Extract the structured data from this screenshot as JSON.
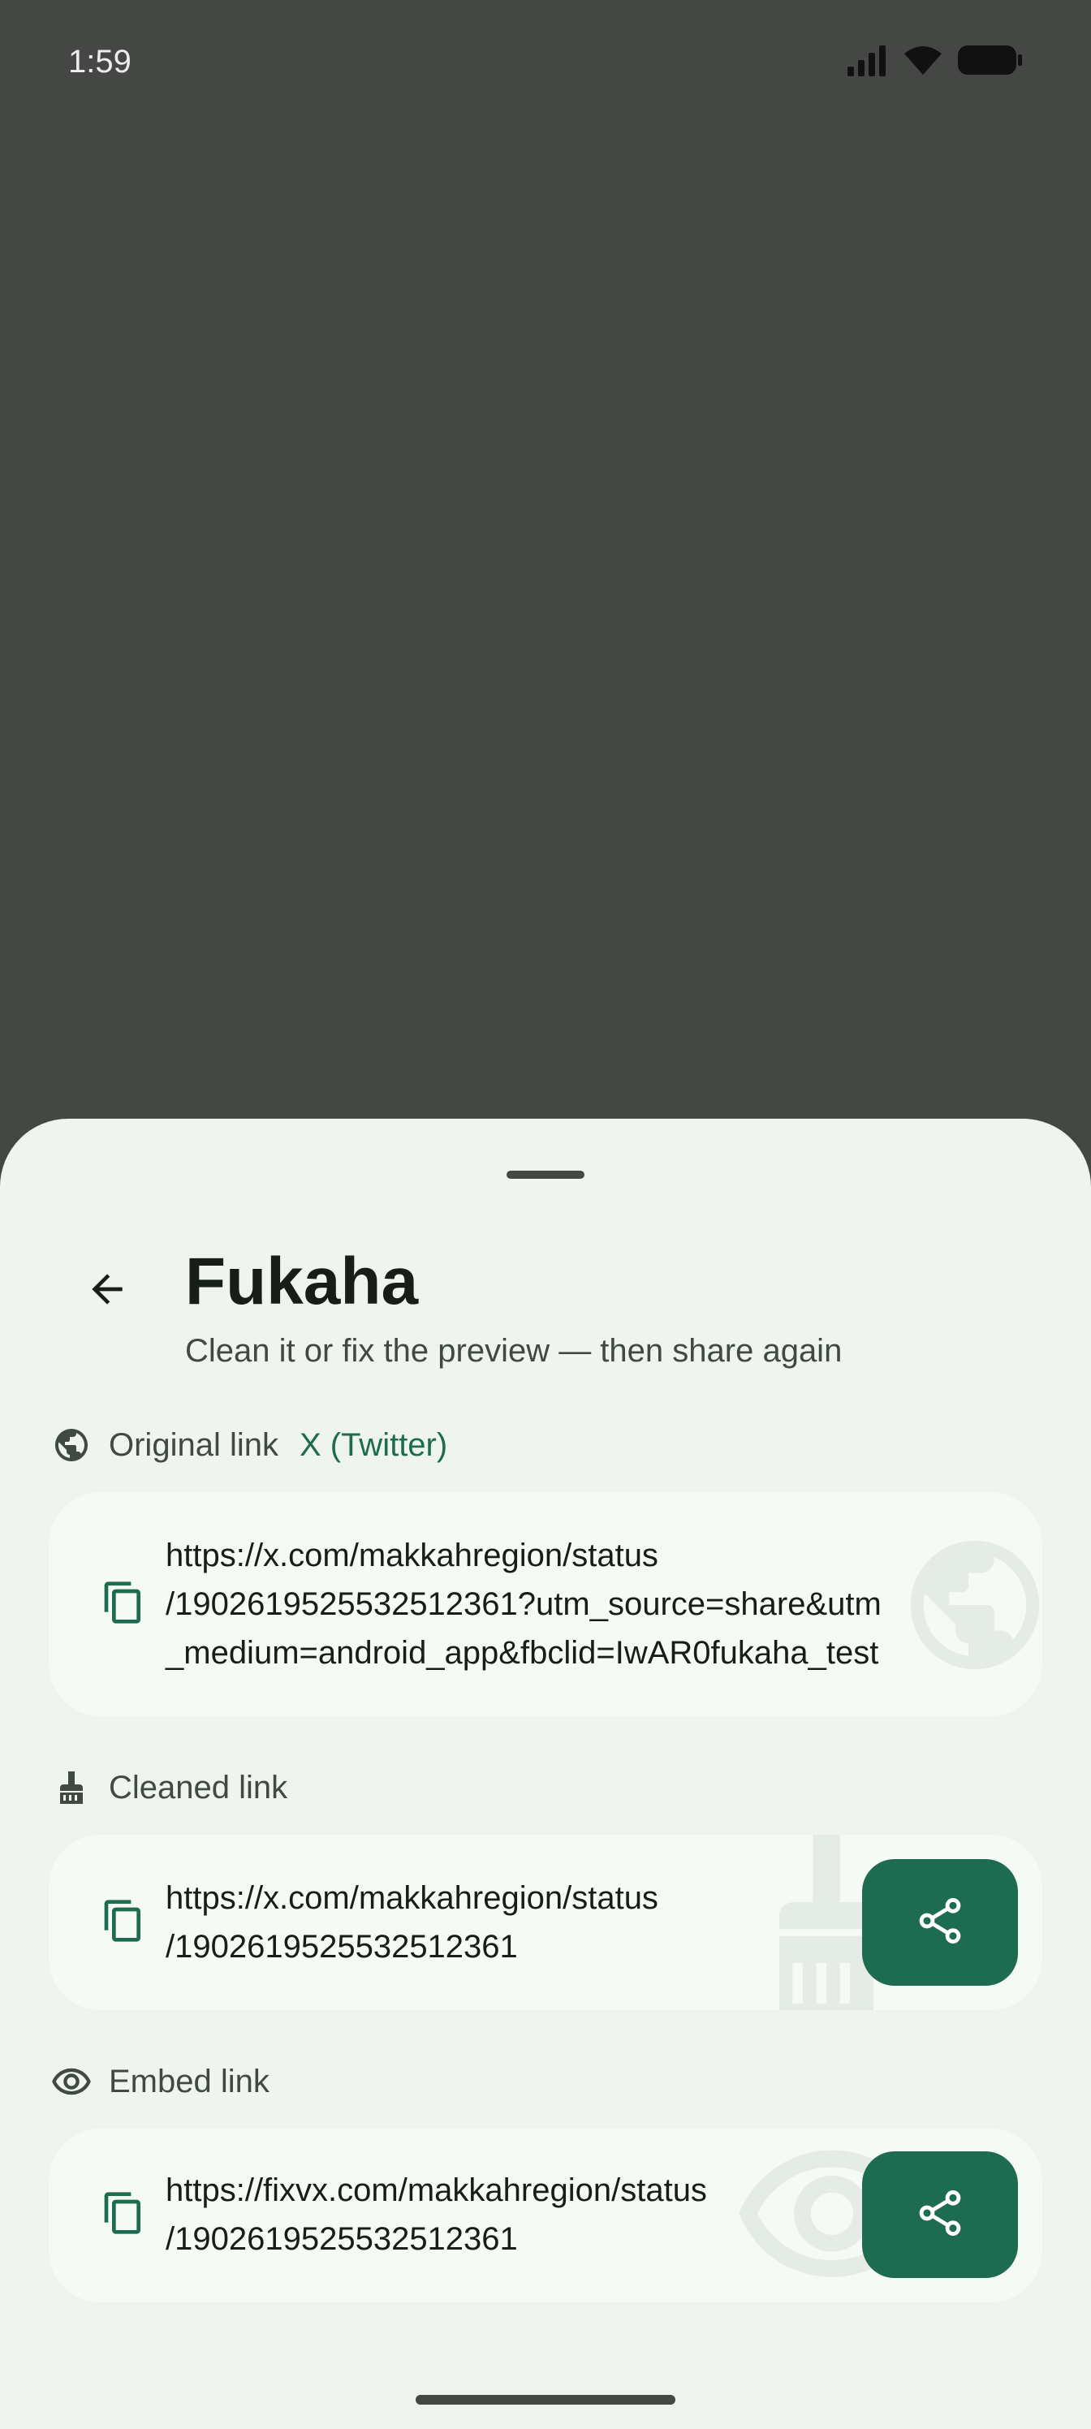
{
  "status_bar": {
    "time": "1:59"
  },
  "sheet": {
    "title": "Fukaha",
    "subtitle": "Clean it or fix the preview — then share again"
  },
  "original": {
    "label": "Original link",
    "platform": "X (Twitter)",
    "url_lines": [
      "https://x.com/makkahregion/status",
      "/1902619525532512361?utm_source=share&utm",
      "_medium=android_app&fbclid=IwAR0fukaha_test"
    ]
  },
  "cleaned": {
    "label": "Cleaned link",
    "url_lines": [
      "https://x.com/makkahregion/status",
      "/1902619525532512361"
    ]
  },
  "embed": {
    "label": "Embed link",
    "url_lines": [
      "https://fixvx.com/makkahregion/status",
      "/1902619525532512361"
    ]
  },
  "icons": {
    "back": "arrow-back-icon",
    "globe": "globe-icon",
    "broom": "broom-icon",
    "eye": "eye-icon",
    "copy": "copy-icon",
    "share": "share-icon"
  },
  "colors": {
    "accent": "#1d6b51",
    "sheet_bg": "#eff4ee",
    "card_bg": "#f6faf5",
    "scrim": "#454745"
  }
}
